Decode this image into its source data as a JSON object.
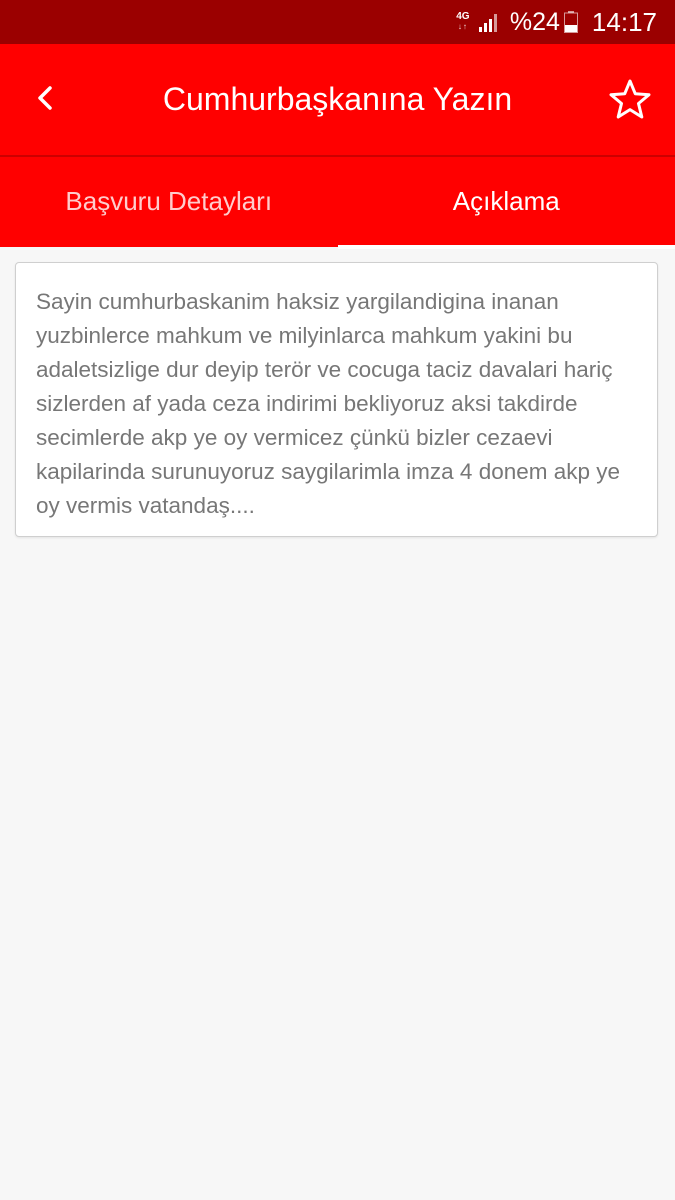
{
  "status_bar": {
    "network_type": "4G",
    "network_arrows": "↓↑",
    "battery_percent": "%24",
    "time": "14:17",
    "icons": [
      "signal-icon",
      "battery-icon"
    ]
  },
  "app_bar": {
    "title": "Cumhurbaşkanına Yazın",
    "icons": [
      "back-icon",
      "star-icon"
    ]
  },
  "tabs": [
    {
      "label": "Başvuru Detayları",
      "selected": false
    },
    {
      "label": "Açıklama",
      "selected": true
    }
  ],
  "content": {
    "message": "Sayin cumhurbaskanim haksiz yargilandigina inanan yuzbinlerce mahkum ve milyinlarca mahkum yakini bu adaletsizlige dur deyip terör ve cocuga taciz davalari hariç sizlerden af yada ceza indirimi bekliyoruz aksi takdirde secimlerde akp ye oy vermicez çünkü bizler cezaevi kapilarinda surunuyoruz saygilarimla imza 4 donem akp ye oy vermis vatandaş...."
  },
  "colors": {
    "status_bar": "#9b0000",
    "app_bar": "#ff0000",
    "background": "#f7f7f7",
    "text": "#777777"
  }
}
